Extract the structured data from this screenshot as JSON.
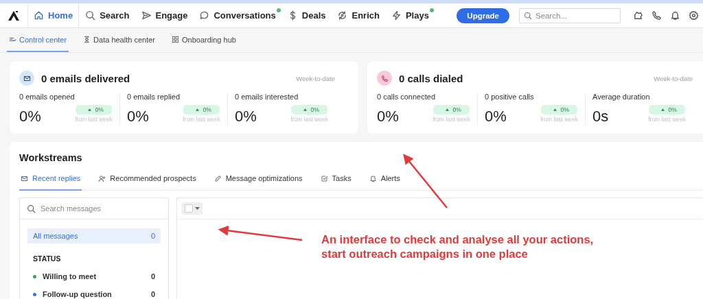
{
  "nav": {
    "items": [
      {
        "label": "Home",
        "selected": true,
        "dot": false
      },
      {
        "label": "Search",
        "selected": false,
        "dot": false
      },
      {
        "label": "Engage",
        "selected": false,
        "dot": false
      },
      {
        "label": "Conversations",
        "selected": false,
        "dot": true
      },
      {
        "label": "Deals",
        "selected": false,
        "dot": false
      },
      {
        "label": "Enrich",
        "selected": false,
        "dot": false
      },
      {
        "label": "Plays",
        "selected": false,
        "dot": true
      }
    ],
    "upgrade": "Upgrade",
    "search": {
      "placeholder": "Search..."
    }
  },
  "subnav": [
    {
      "label": "Control center",
      "selected": true
    },
    {
      "label": "Data health center",
      "selected": false
    },
    {
      "label": "Onboarding hub",
      "selected": false
    }
  ],
  "cards": [
    {
      "title": "0 emails delivered",
      "period": "Week-to-date",
      "color": "#d4e6fa",
      "metrics": [
        {
          "label": "0 emails opened",
          "value": "0%",
          "change": "0%",
          "note": "from last week"
        },
        {
          "label": "0 emails replied",
          "value": "0%",
          "change": "0%",
          "note": "from last week"
        },
        {
          "label": "0 emails interested",
          "value": "0%",
          "change": "0%",
          "note": "from last week"
        }
      ]
    },
    {
      "title": "0 calls dialed",
      "period": "Week-to-date",
      "color": "#f6c9dc",
      "metrics": [
        {
          "label": "0 calls connected",
          "value": "0%",
          "change": "0%",
          "note": "from last week"
        },
        {
          "label": "0 positive calls",
          "value": "0%",
          "change": "0%",
          "note": "from last week"
        },
        {
          "label": "Average duration",
          "value": "0s",
          "change": "0%",
          "note": "from last week"
        }
      ]
    }
  ],
  "workstreams": {
    "title": "Workstreams",
    "tabs": [
      {
        "label": "Recent replies",
        "selected": true
      },
      {
        "label": "Recommended prospects",
        "selected": false
      },
      {
        "label": "Message optimizations",
        "selected": false
      },
      {
        "label": "Tasks",
        "selected": false
      },
      {
        "label": "Alerts",
        "selected": false
      }
    ],
    "search": {
      "placeholder": "Search messages"
    },
    "filters": [
      {
        "label": "All messages",
        "count": "0",
        "selected": true
      }
    ],
    "status_heading": "STATUS",
    "statuses": [
      {
        "label": "Willing to meet",
        "count": "0",
        "color": "#3f9c62"
      },
      {
        "label": "Follow-up question",
        "count": "0",
        "color": "#3d6fe6"
      }
    ],
    "select_all": {
      "checked": false
    }
  },
  "annotation": {
    "lines": [
      "An interface to check and analyse all your actions,",
      "start outreach campaigns in one place"
    ]
  }
}
